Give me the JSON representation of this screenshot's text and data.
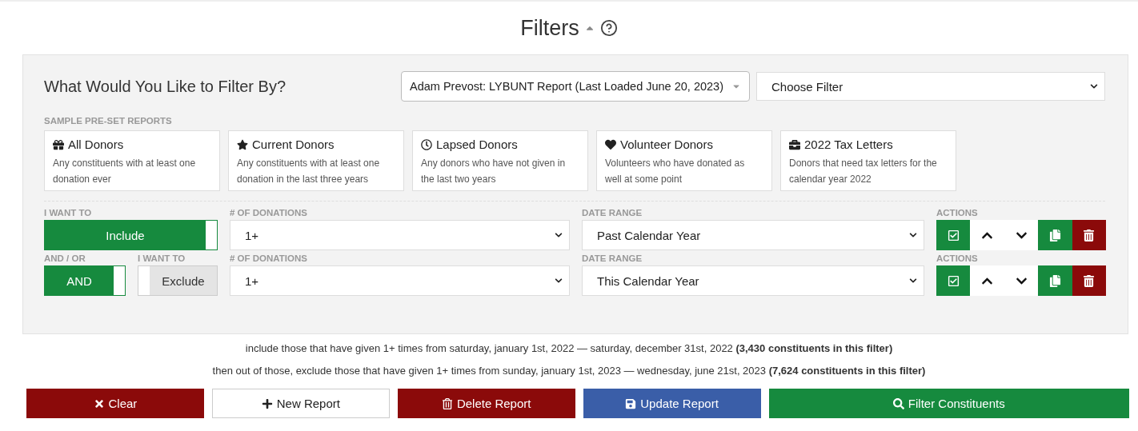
{
  "title": "Filters",
  "panel": {
    "heading": "What Would You Like to Filter By?",
    "report_select": "Adam Prevost: LYBUNT Report (Last Loaded June 20, 2023)",
    "filter_select": "Choose Filter",
    "presets_label": "SAMPLE PRE-SET REPORTS",
    "presets": [
      {
        "kind": "gift",
        "title": "All Donors",
        "text": "Any constituents with at least one donation ever"
      },
      {
        "kind": "star",
        "title": "Current Donors",
        "text": "Any constituents with at least one donation in the last three years"
      },
      {
        "kind": "clock",
        "title": "Lapsed Donors",
        "text": "Any donors who have not given in the last two years"
      },
      {
        "kind": "heart",
        "title": "Volunteer Donors",
        "text": "Volunteers who have donated as well at some point"
      },
      {
        "kind": "briefcase",
        "title": "2022 Tax Letters",
        "text": "Donors that need tax letters for the calendar year 2022"
      }
    ],
    "rules": [
      {
        "want_label": "I WANT TO",
        "want": {
          "label": "Include",
          "on": true
        },
        "donations_label": "# OF DONATIONS",
        "donations": "1+",
        "date_label": "DATE RANGE",
        "date": "Past Calendar Year",
        "actions_label": "ACTIONS"
      },
      {
        "andor_label": "AND / OR",
        "andor": {
          "label": "AND",
          "on": true
        },
        "want_label": "I WANT TO",
        "want": {
          "label": "Exclude",
          "on": false
        },
        "donations_label": "# OF DONATIONS",
        "donations": "1+",
        "date_label": "DATE RANGE",
        "date": "This Calendar Year",
        "actions_label": "ACTIONS"
      }
    ]
  },
  "summary": [
    "include those that have given 1+ times from saturday, january 1st, 2022 — saturday, december 31st, 2022 **(3,430 constituents in this filter)**",
    "then out of those, exclude those that have given 1+ times from sunday, january 1st, 2023 — wednesday, june 21st, 2023 **(7,624 constituents in this filter)**"
  ],
  "buttons": [
    {
      "kind": "clear",
      "label": "Clear"
    },
    {
      "kind": "new",
      "label": "New Report"
    },
    {
      "kind": "delete",
      "label": "Delete Report"
    },
    {
      "kind": "update",
      "label": "Update Report"
    },
    {
      "kind": "filter",
      "label": "Filter Constituents"
    }
  ]
}
